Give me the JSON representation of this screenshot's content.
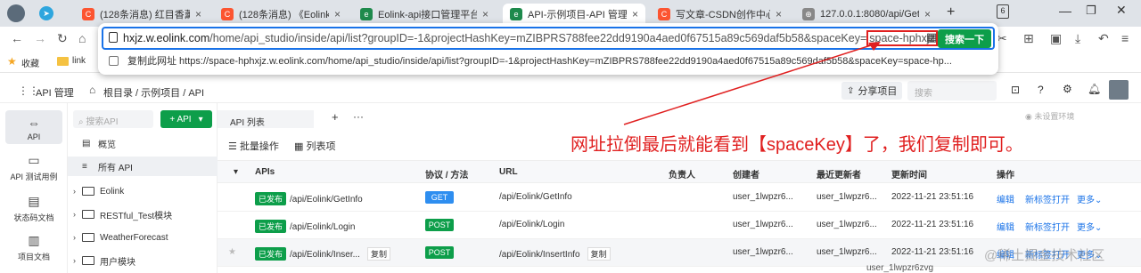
{
  "tabs": [
    {
      "label": "(128条消息) 红目香薰的博",
      "fav_color": "#fc5531",
      "fav_glyph": "C"
    },
    {
      "label": "(128条消息) 《Eolink 征文",
      "fav_color": "#fc5531",
      "fav_glyph": "C"
    },
    {
      "label": "Eolink-api接口管理平台_a",
      "fav_color": "#1e8a4c",
      "fav_glyph": "e"
    },
    {
      "label": "API-示例项目-API 管理",
      "fav_color": "#1e8a4c",
      "fav_glyph": "e"
    },
    {
      "label": "写文章-CSDN创作中心",
      "fav_color": "#fc5531",
      "fav_glyph": "C"
    },
    {
      "label": "127.0.0.1:8080/api/GetI",
      "fav_color": "#888888",
      "fav_glyph": "⊕"
    }
  ],
  "new_tab": "+",
  "tab_count": "6",
  "bookmarks": {
    "fav": "收藏",
    "link": "link"
  },
  "omnibox": {
    "host": "hxjz.w.eolink.com",
    "path": "/home/api_studio/inside/api/list?groupID=-1&projectHashKey=mZIBPRS788fee22dd9190a4aed0f67515a89c569daf5b58&spaceKey=",
    "highlight": "space-hphxjz",
    "search_label": "搜索一下",
    "copy_text": "复制此网址 https://space-hphxjz.w.eolink.com/home/api_studio/inside/api/list?groupID=-1&projectHashKey=mZIBPRS788fee22dd9190a4aed0f67515a89c569daf5b58&spaceKey=space-hp..."
  },
  "app": {
    "api_mgmt": "API 管理",
    "breadcrumb": "根目录 / 示例项目 / API",
    "share": "分享项目",
    "search_placeholder": "搜索"
  },
  "leftnav": [
    "API",
    "API 测试用例",
    "状态码文档",
    "项目文档"
  ],
  "tree": {
    "search_placeholder": "搜索API",
    "add_api": "+ API",
    "items": [
      "概览",
      "所有 API",
      "Eolink",
      "RESTful_Test模块",
      "WeatherForecast",
      "用户模块"
    ]
  },
  "main": {
    "tab_label": "API 列表",
    "batch": "批量操作",
    "columns_btn": "列表项",
    "env": "未设置环境",
    "columns": [
      "APIs",
      "协议 / 方法",
      "URL",
      "负责人",
      "创建者",
      "最近更新者",
      "更新时间",
      "操作"
    ],
    "rows": [
      {
        "status": "已发布",
        "path": "/api/Eolink/GetInfo",
        "method": "GET",
        "method_color": "#2e8ef0",
        "url": "/api/Eolink/GetInfo",
        "creator": "user_1lwpzr6...",
        "updater": "user_1lwpzr6...",
        "time": "2022-11-21 23:51:16",
        "edit": "编辑",
        "open": "新标签打开",
        "more": "更多⌄",
        "copy": ""
      },
      {
        "status": "已发布",
        "path": "/api/Eolink/Login",
        "method": "POST",
        "method_color": "#0d9e4a",
        "url": "/api/Eolink/Login",
        "creator": "user_1lwpzr6...",
        "updater": "user_1lwpzr6...",
        "time": "2022-11-21 23:51:16",
        "edit": "编辑",
        "open": "新标签打开",
        "more": "更多⌄",
        "copy": ""
      },
      {
        "status": "已发布",
        "path": "/api/Eolink/Inser...",
        "method": "POST",
        "method_color": "#0d9e4a",
        "url": "/api/Eolink/InsertInfo",
        "creator": "user_1lwpzr6...",
        "updater": "user_1lwpzr6...",
        "time": "2022-11-21 23:51:16",
        "edit": "编辑",
        "open": "新标签打开",
        "more": "更多⌄",
        "copy": "复制"
      }
    ],
    "partial_row": "user_1lwpzr6zvg"
  },
  "annotation": "网址拉倒最后就能看到【spaceKey】了，我们复制即可。",
  "watermark": "@稀土掘金技术社区"
}
